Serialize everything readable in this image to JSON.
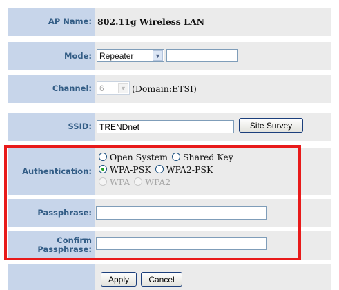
{
  "ap": {
    "label": "AP Name:",
    "value": "802.11g Wireless LAN"
  },
  "mode": {
    "label": "Mode:",
    "selected": "Repeater",
    "text_value": ""
  },
  "channel": {
    "label": "Channel:",
    "selected": "6",
    "domain_text": "(Domain:ETSI)"
  },
  "ssid": {
    "label": "SSID:",
    "value": "TRENDnet",
    "site_survey_label": "Site Survey"
  },
  "authentication": {
    "label": "Authentication:",
    "options": {
      "open_system": "Open System",
      "shared_key": "Shared Key",
      "wpa_psk": "WPA-PSK",
      "wpa2_psk": "WPA2-PSK",
      "wpa": "WPA",
      "wpa2": "WPA2"
    },
    "selected": "WPA-PSK"
  },
  "passphrase": {
    "label": "Passphrase:",
    "value": ""
  },
  "confirm": {
    "label_line1": "Confirm",
    "label_line2": "Passphrase:",
    "value": ""
  },
  "buttons": {
    "apply": "Apply",
    "cancel": "Cancel"
  },
  "colors": {
    "label_bg": "#c7d5ea",
    "label_text": "#335d86",
    "value_bg": "#ebebeb",
    "highlight": "#e81a1a"
  }
}
